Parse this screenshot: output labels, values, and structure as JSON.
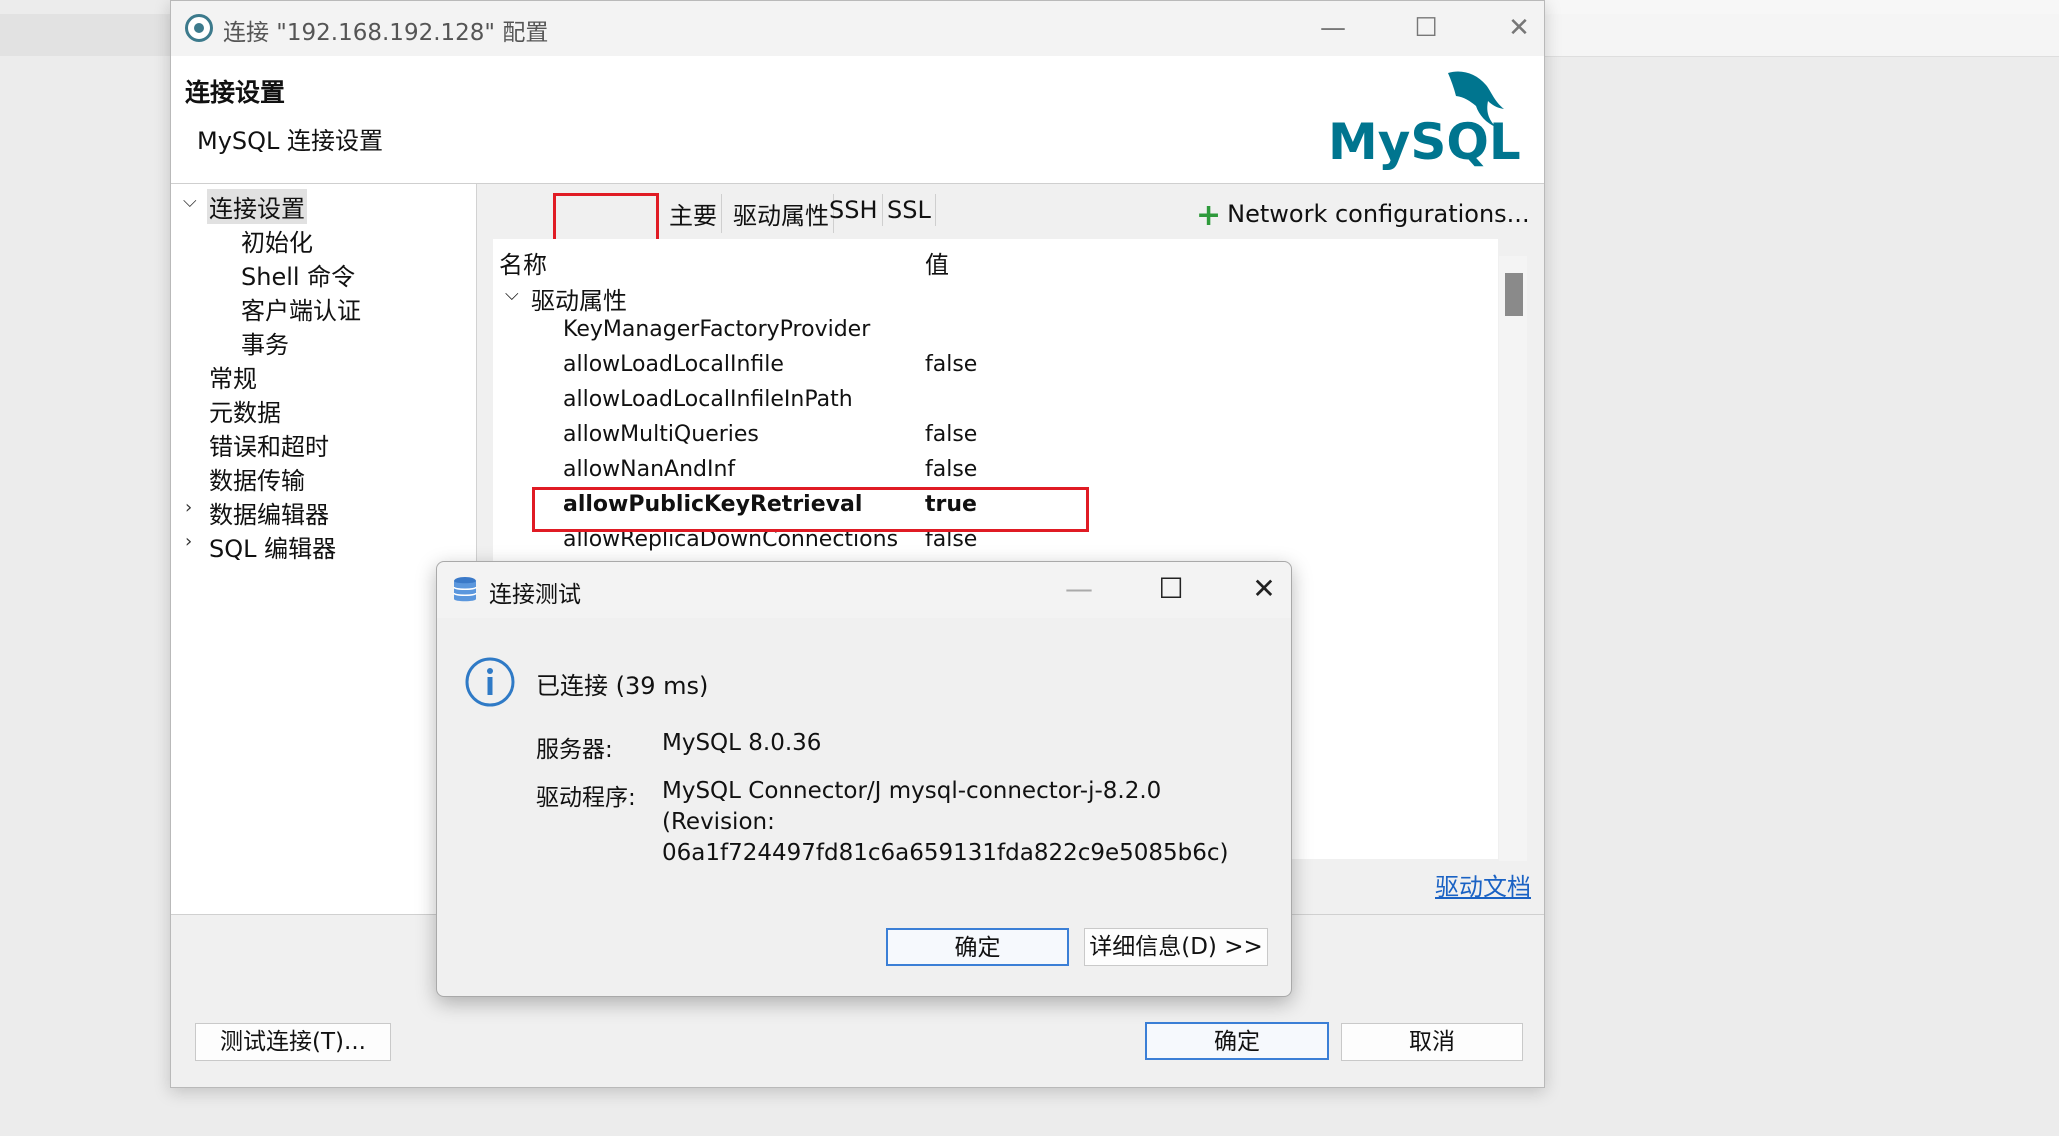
{
  "window": {
    "title": "连接 \"192.168.192.128\" 配置",
    "minimize": "—",
    "maximize": "☐",
    "close": "✕"
  },
  "header": {
    "title": "连接设置",
    "subtitle": "MySQL 连接设置",
    "logo_text": "MySQL"
  },
  "tree": {
    "root": "连接设置",
    "children": [
      "初始化",
      "Shell 命令",
      "客户端认证",
      "事务"
    ],
    "items": [
      "常规",
      "元数据",
      "错误和超时",
      "数据传输"
    ],
    "expandable": [
      "数据编辑器",
      "SQL 编辑器"
    ]
  },
  "tabs": [
    "主要",
    "驱动属性",
    "SSH",
    "SSL"
  ],
  "network_button": "Network configurations...",
  "props": {
    "col_name": "名称",
    "col_value": "值",
    "group": "驱动属性",
    "rows": [
      {
        "name": "KeyManagerFactoryProvider",
        "value": ""
      },
      {
        "name": "allowLoadLocalInfile",
        "value": "false"
      },
      {
        "name": "allowLoadLocalInfileInPath",
        "value": ""
      },
      {
        "name": "allowMultiQueries",
        "value": "false"
      },
      {
        "name": "allowNanAndInf",
        "value": "false"
      },
      {
        "name": "allowPublicKeyRetrieval",
        "value": "true"
      },
      {
        "name": "allowReplicaDownConnections",
        "value": "false"
      }
    ]
  },
  "doc_link": "驱动文档",
  "buttons": {
    "test": "测试连接(T)...",
    "ok": "确定",
    "cancel": "取消"
  },
  "dialog": {
    "title": "连接测试",
    "message": "已连接 (39 ms)",
    "server_label": "服务器:",
    "server_value": "MySQL 8.0.36",
    "driver_label": "驱动程序:",
    "driver_line1": "MySQL Connector/J mysql-connector-j-8.2.0",
    "driver_line2": "(Revision:",
    "driver_line3": "06a1f724497fd81c6a659131fda822c9e5085b6c)",
    "ok": "确定",
    "details": "详细信息(D) >>"
  },
  "colors": {
    "highlight": "#e01b24",
    "link": "#1a62c4",
    "accent": "#3b7fd6",
    "mysql_teal": "#00758f",
    "mysql_orange": "#f29111"
  }
}
